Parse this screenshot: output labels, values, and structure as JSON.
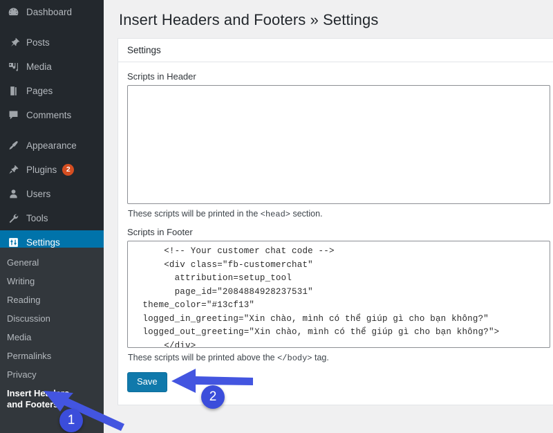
{
  "page": {
    "title": "Insert Headers and Footers » Settings"
  },
  "sidebar": {
    "items": [
      {
        "label": "Dashboard",
        "icon": "dashboard-icon",
        "badge": null
      },
      {
        "label": "Posts",
        "icon": "pin-icon",
        "badge": null
      },
      {
        "label": "Media",
        "icon": "media-icon",
        "badge": null
      },
      {
        "label": "Pages",
        "icon": "pages-icon",
        "badge": null
      },
      {
        "label": "Comments",
        "icon": "comment-icon",
        "badge": null
      },
      {
        "label": "Appearance",
        "icon": "brush-icon",
        "badge": null
      },
      {
        "label": "Plugins",
        "icon": "plugin-icon",
        "badge": "2"
      },
      {
        "label": "Users",
        "icon": "user-icon",
        "badge": null
      },
      {
        "label": "Tools",
        "icon": "wrench-icon",
        "badge": null
      },
      {
        "label": "Settings",
        "icon": "sliders-icon",
        "badge": null
      }
    ],
    "submenu": [
      {
        "label": "General"
      },
      {
        "label": "Writing"
      },
      {
        "label": "Reading"
      },
      {
        "label": "Discussion"
      },
      {
        "label": "Media"
      },
      {
        "label": "Permalinks"
      },
      {
        "label": "Privacy"
      },
      {
        "label": "Insert Headers and Footers"
      }
    ],
    "active_item": "Settings",
    "active_submenu": "Insert Headers and Footers",
    "colors": {
      "background": "#23282d",
      "submenu_background": "#32373c",
      "active_background": "#0073aa",
      "badge_background": "#d54e21",
      "text": "#b4b9be"
    }
  },
  "card": {
    "header": "Settings",
    "header_field": {
      "label": "Scripts in Header",
      "value": "",
      "help": "These scripts will be printed in the <code><head></code> section."
    },
    "footer_field": {
      "label": "Scripts in Footer",
      "value": "      <!-- Your customer chat code -->\n      <div class=\"fb-customerchat\"\n        attribution=setup_tool\n        page_id=\"2084884928237531\"\n  theme_color=\"#13cf13\"\n  logged_in_greeting=\"Xin chào, mình có thể giúp gì cho bạn không?\"\n  logged_out_greeting=\"Xin chào, mình có thể giúp gì cho bạn không?\">\n      </div>",
      "help": "These scripts will be printed above the <code></body></code> tag."
    },
    "save_label": "Save",
    "save_color": "#1079ab"
  },
  "annotations": {
    "marker_1": "1",
    "marker_2": "2",
    "arrow_color": "#4355e0"
  }
}
